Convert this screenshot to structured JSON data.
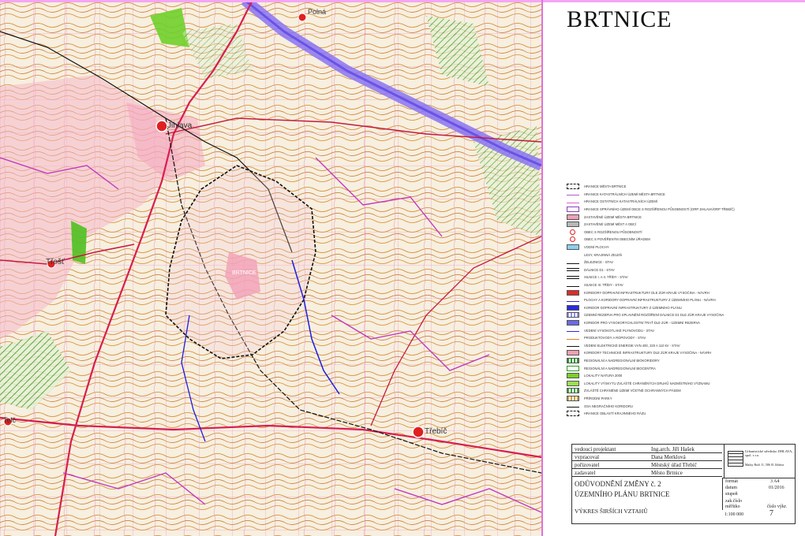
{
  "title": "BRTNICE",
  "map": {
    "places": [
      {
        "name": "Polná"
      },
      {
        "name": "Jihlava"
      },
      {
        "name": "Třešť"
      },
      {
        "name": "BRTNICE"
      },
      {
        "name": "Třebíč"
      },
      {
        "name": "Telč"
      }
    ]
  },
  "legend": [
    {
      "label": "HRANICE MĚSTA BRTNICE",
      "color": "#111111",
      "style": "dashed"
    },
    {
      "label": "HRANICE KATASTRÁLNÍCH ÚZEMÍ MĚSTA BRTNICE",
      "color": "#b05cc8",
      "style": "line"
    },
    {
      "label": "HRANICE OSTATNÍCH KATASTRÁLNÍCH ÚZEMÍ",
      "color": "#e05cd0",
      "style": "line"
    },
    {
      "label": "HRANICE SPRÁVNÍHO ÚZEMÍ OBCE S ROZŠÍŘENOU PŮSOBNOSTÍ (ORP JIHLAVA/ORP TŘEBÍČ)",
      "color": "#8a3ec0",
      "style": "box"
    },
    {
      "label": "ZASTAVĚNÉ ÚZEMÍ MĚSTA BRTNICE",
      "color": "#f2a0b8",
      "style": "fill"
    },
    {
      "label": "ZASTAVĚNÉ ÚZEMÍ MĚST A OBCÍ",
      "color": "#b8b8b8",
      "style": "fill"
    },
    {
      "label": "OBEC S ROZŠÍŘENOU PŮSOBNOSTÍ",
      "color": "#e02020",
      "style": "circle"
    },
    {
      "label": "OBEC S POVĚŘENÝM OBECNÍM ÚŘADEM",
      "color": "#e02020",
      "style": "circle"
    },
    {
      "label": "VODNÍ PLOCHY",
      "color": "#8ad0f0",
      "style": "fill"
    },
    {
      "label": "LESY, KRAJINNÁ ZELEŇ",
      "color": "#ffffff",
      "style": "box"
    },
    {
      "label": "ŽELEZNICE - STAV",
      "color": "#111111",
      "style": "line"
    },
    {
      "label": "DÁLNICE D1 - STAV",
      "color": "#111111",
      "style": "double"
    },
    {
      "label": "SILNICE I. A II. TŘÍDY - STAV",
      "color": "#111111",
      "style": "double"
    },
    {
      "label": "SILNICE III. TŘÍDY - STAV",
      "color": "#111111",
      "style": "line"
    },
    {
      "label": "KORIDORY DOPRAVNÍ INFRASTRUKTURY DLE ZÚR KRAJE VYSOČINA - NÁVRH",
      "color": "#e02a2a",
      "style": "fill"
    },
    {
      "label": "PLOCHY A KORIDORY DOPRAVNÍ INFRASTRUKTURY Z ÚZEMNÍHO PLÁNU - NÁVRH",
      "color": "#2a2ae0",
      "style": "line"
    },
    {
      "label": "KORIDOR DOPRAVNÍ INFRASTRUKTURY Z ÚZEMNÍHO PLÁNU",
      "color": "#2a2ae0",
      "style": "fill"
    },
    {
      "label": "ÚZEMNÍ REZERVA PRO SPLAVNĚNÍ ROZŠÍŘENÍ DÁLNICE D1 DLE ZÚR KRAJE VYSOČINA",
      "color": "#9090f0",
      "style": "hatch"
    },
    {
      "label": "KORIDOR PRO VYSOKORYCHLOSTNÍ TRAŤ DLE ZÚR - ÚZEMNÍ REZERVA",
      "color": "#6a6ae8",
      "style": "fill"
    },
    {
      "label": "VEDENÍ VYSOKOTLAKÉ PLYNOVODU - STAV",
      "color": "#2a2ae0",
      "style": "line"
    },
    {
      "label": "PRODUKTOVODY A ROPOVODY - STAV",
      "color": "#e08020",
      "style": "line"
    },
    {
      "label": "VEDENÍ ELEKTRICKÉ ENERGIE VVN 400, 220 A 110 kV - STAV",
      "color": "#111111",
      "style": "line"
    },
    {
      "label": "KORIDORY TECHNICKÉ INFRASTRUKTURY DLE ZÚR KRAJE VYSOČINA - NÁVRH",
      "color": "#f0a0b0",
      "style": "fill"
    },
    {
      "label": "REGIONÁLNÍ A NADREGIONÁLNÍ BIOKORIDORY",
      "color": "#2a9a2a",
      "style": "hatch"
    },
    {
      "label": "REGIONÁLNÍ A NADREGIONÁLNÍ BIOCENTRA",
      "color": "#2a9a2a",
      "style": "box"
    },
    {
      "label": "LOKALITY NATURA 2000",
      "color": "#7ad02a",
      "style": "fill"
    },
    {
      "label": "LOKALITY VÝSKYTU ZVLÁŠTĚ CHRÁNĚNÝCH DRUHŮ NADMÍSTNÍHO VÝZNAMU",
      "color": "#9ae050",
      "style": "fill"
    },
    {
      "label": "ZVLÁŠTĚ CHRÁNĚNÉ ÚZEMÍ VČETNĚ OCHRANNÝCH PÁSEM",
      "color": "#40a040",
      "style": "hatch"
    },
    {
      "label": "PŘÍRODNÍ PARKY",
      "color": "#c8a040",
      "style": "hatch"
    },
    {
      "label": "OSA NEGRAČNÍHO KORIDORU",
      "color": "#111111",
      "style": "line"
    },
    {
      "label": "HRANICE OBLASTÍ KRAJINNÉHO RÁZU",
      "color": "#111111",
      "style": "dashed"
    }
  ],
  "titleblock": {
    "rows": [
      {
        "label": "vedoucí projektant",
        "value": "Ing.arch. Jiří Hašek"
      },
      {
        "label": "vypracoval",
        "value": "Dana Merklová"
      },
      {
        "label": "pořizovatel",
        "value": "Městský úřad Třebíč"
      },
      {
        "label": "zadavatel",
        "value": "Město Brtnice"
      }
    ],
    "company": "Urbanistické středisko JIHLAVA, spol. s r.o.",
    "company_addr": "Matky Boží 11, 586 01 Jihlava",
    "doc_title_1": "ODŮVODNĚNÍ ZMĚNY č. 2",
    "doc_title_2": "ÚZEMNÍHO PLÁNU BRTNICE",
    "format_label": "formát",
    "format_value": "3 A4",
    "date_label": "datum",
    "date_value": "01/2016",
    "stupen_label": "stupeň",
    "zak_label": "zak.číslo",
    "drawing_title": "VÝKRES ŠIRŠÍCH VZTAHŮ",
    "scale_label": "měřítko",
    "scale_value": "1:100 000",
    "sheet_label": "číslo výkr.",
    "sheet_value": "7"
  }
}
